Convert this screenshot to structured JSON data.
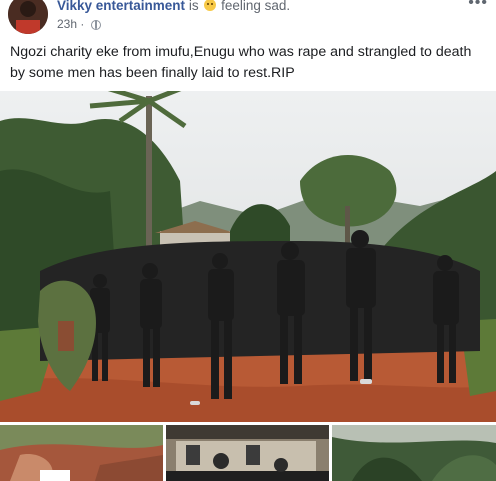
{
  "post": {
    "author": "Vikky entertainment",
    "is_text": "is",
    "feeling_text": "feeling sad.",
    "timestamp": "23h",
    "body": "Ngozi charity eke from imufu,Enugu who was rape and strangled to death by some men has been finally laid to rest.RIP",
    "more_label": "•••"
  },
  "icons": {
    "feeling": "sad-face-emoji-icon",
    "privacy": "globe-icon",
    "menu": "more-options-icon"
  },
  "colors": {
    "author_link": "#385898",
    "secondary_text": "#616770",
    "body_text": "#1c1e21"
  }
}
